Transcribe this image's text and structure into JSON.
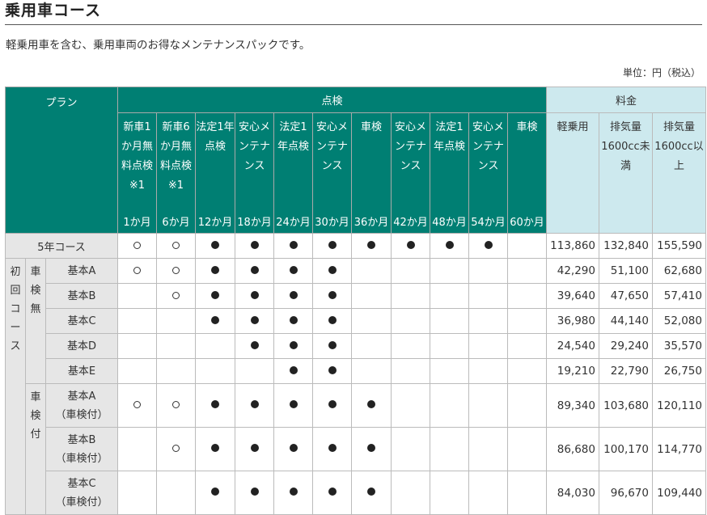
{
  "title": "乗用車コース",
  "description": "軽乗用車を含む、乗用車両のお得なメンテナンスパックです。",
  "unit": "単位：円（税込）",
  "headers": {
    "plan": "プラン",
    "inspection": "点検",
    "fee": "料金",
    "items": [
      {
        "label": "新車1か月無料点検※1",
        "month": "1か月"
      },
      {
        "label": "新車6か月無料点検※1",
        "month": "6か月"
      },
      {
        "label": "法定1年点検",
        "month": "12か月"
      },
      {
        "label": "安心メンテナンス",
        "month": "18か月"
      },
      {
        "label": "法定1年点検",
        "month": "24か月"
      },
      {
        "label": "安心メンテナンス",
        "month": "30か月"
      },
      {
        "label": "車検",
        "month": "36か月"
      },
      {
        "label": "安心メンテナンス",
        "month": "42か月"
      },
      {
        "label": "法定1年点検",
        "month": "48か月"
      },
      {
        "label": "安心メンテナンス",
        "month": "54か月"
      },
      {
        "label": "車検",
        "month": "60か月"
      }
    ],
    "fees": [
      "軽乗用",
      "排気量1600cc未満",
      "排気量1600cc以上"
    ]
  },
  "group": {
    "first_course": "初回コース",
    "no_inspection": "車検無",
    "with_inspection": "車検付"
  },
  "rows": [
    {
      "name": "5年コース",
      "marks": [
        "○",
        "○",
        "●",
        "●",
        "●",
        "●",
        "●",
        "●",
        "●",
        "●",
        ""
      ],
      "prices": [
        "113,860",
        "132,840",
        "155,590"
      ]
    },
    {
      "name": "基本A",
      "marks": [
        "○",
        "○",
        "●",
        "●",
        "●",
        "●",
        "",
        "",
        "",
        "",
        ""
      ],
      "prices": [
        "42,290",
        "51,100",
        "62,680"
      ]
    },
    {
      "name": "基本B",
      "marks": [
        "",
        "○",
        "●",
        "●",
        "●",
        "●",
        "",
        "",
        "",
        "",
        ""
      ],
      "prices": [
        "39,640",
        "47,650",
        "57,410"
      ]
    },
    {
      "name": "基本C",
      "marks": [
        "",
        "",
        "●",
        "●",
        "●",
        "●",
        "",
        "",
        "",
        "",
        ""
      ],
      "prices": [
        "36,980",
        "44,140",
        "52,080"
      ]
    },
    {
      "name": "基本D",
      "marks": [
        "",
        "",
        "",
        "●",
        "●",
        "●",
        "",
        "",
        "",
        "",
        ""
      ],
      "prices": [
        "24,540",
        "29,240",
        "35,570"
      ]
    },
    {
      "name": "基本E",
      "marks": [
        "",
        "",
        "",
        "",
        "●",
        "●",
        "",
        "",
        "",
        "",
        ""
      ],
      "prices": [
        "19,210",
        "22,790",
        "26,750"
      ]
    },
    {
      "name": "基本A",
      "note": "（車検付）",
      "marks": [
        "○",
        "○",
        "●",
        "●",
        "●",
        "●",
        "●",
        "",
        "",
        "",
        ""
      ],
      "prices": [
        "89,340",
        "103,680",
        "120,110"
      ]
    },
    {
      "name": "基本B",
      "note": "（車検付）",
      "marks": [
        "",
        "○",
        "●",
        "●",
        "●",
        "●",
        "●",
        "",
        "",
        "",
        ""
      ],
      "prices": [
        "86,680",
        "100,170",
        "114,770"
      ]
    },
    {
      "name": "基本C",
      "note": "（車検付）",
      "marks": [
        "",
        "",
        "●",
        "●",
        "●",
        "●",
        "●",
        "",
        "",
        "",
        ""
      ],
      "prices": [
        "84,030",
        "96,670",
        "109,440"
      ]
    }
  ]
}
